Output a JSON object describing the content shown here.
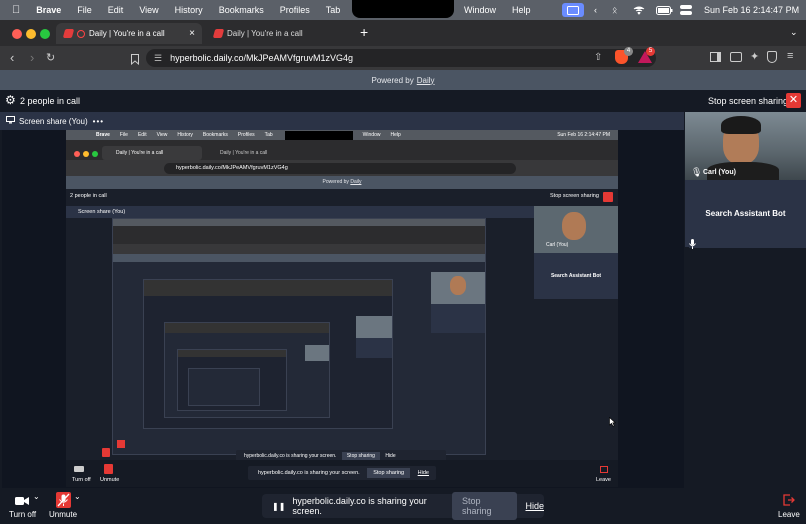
{
  "menubar": {
    "app": "Brave",
    "items": [
      "File",
      "Edit",
      "View",
      "History",
      "Bookmarks",
      "Profiles",
      "Tab"
    ],
    "right_items": [
      "Window",
      "Help"
    ],
    "datetime": "Sun Feb 16  2:14:47 PM"
  },
  "browser": {
    "tabs": [
      {
        "title": "Daily | You're in a call",
        "active": true
      },
      {
        "title": "Daily | You're in a call",
        "active": false
      }
    ],
    "new_tab": "+",
    "close_tab": "×",
    "url": "hyperbolic.daily.co/MkJPeAMVfgruvM1zVG4g",
    "shield_badge": "4",
    "rewards_badge": "5"
  },
  "daily": {
    "powered_by": "Powered by",
    "powered_brand": "Daily",
    "people_count": "2 people in call",
    "stop_sharing_top": "Stop screen sharing",
    "screen_share_label": "Screen share (You)",
    "participants": [
      {
        "name": "Carl (You)"
      },
      {
        "name": "Search Assistant Bot"
      }
    ],
    "tray": {
      "turn_off": "Turn off",
      "unmute": "Unmute",
      "leave": "Leave"
    },
    "share_banner": {
      "text": "hyperbolic.daily.co is sharing your screen.",
      "stop": "Stop sharing",
      "hide": "Hide"
    }
  },
  "inner_capture": {
    "datetime": "Sun Feb 16  2:14:47 PM",
    "url": "hyperbolic.daily.co/MkJPeAMVfgruvM1zVG4g",
    "people_count": "2 people in call",
    "stop_sharing_top": "Stop screen sharing",
    "screen_share_label": "Screen share (You)",
    "carl": "Carl (You)",
    "bot": "Search Assistant Bot",
    "turn_off": "Turn off",
    "unmute": "Unmute",
    "leave": "Leave",
    "banner_text": "hyperbolic.daily.co is sharing your screen.",
    "banner_stop": "Stop sharing",
    "banner_hide": "Hide",
    "powered_by": "Powered by",
    "powered_brand": "Daily",
    "tab_title": "Daily | You're in a call"
  },
  "colors": {
    "accent_red": "#e53935",
    "window_bg": "#151a24",
    "tile_bg": "#2b3346"
  }
}
